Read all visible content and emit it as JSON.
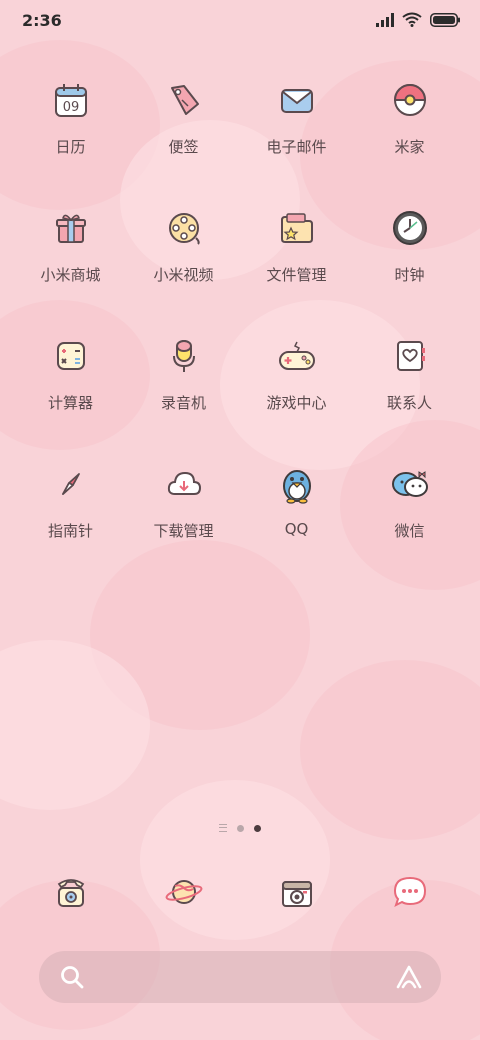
{
  "status_bar": {
    "time": "2:36"
  },
  "apps": [
    {
      "label": "日历",
      "icon": "calendar-icon",
      "day": "09"
    },
    {
      "label": "便签",
      "icon": "notes-icon"
    },
    {
      "label": "电子邮件",
      "icon": "email-icon"
    },
    {
      "label": "米家",
      "icon": "mijia-icon"
    },
    {
      "label": "小米商城",
      "icon": "gift-icon"
    },
    {
      "label": "小米视频",
      "icon": "film-reel-icon"
    },
    {
      "label": "文件管理",
      "icon": "folder-icon"
    },
    {
      "label": "时钟",
      "icon": "clock-icon"
    },
    {
      "label": "计算器",
      "icon": "calculator-icon"
    },
    {
      "label": "录音机",
      "icon": "microphone-icon"
    },
    {
      "label": "游戏中心",
      "icon": "gamepad-icon"
    },
    {
      "label": "联系人",
      "icon": "contacts-icon"
    },
    {
      "label": "指南针",
      "icon": "compass-icon"
    },
    {
      "label": "下载管理",
      "icon": "cloud-download-icon"
    },
    {
      "label": "QQ",
      "icon": "penguin-icon"
    },
    {
      "label": "微信",
      "icon": "wechat-icon"
    }
  ],
  "pager": {
    "pages": 2,
    "active_page": 2
  },
  "dock": [
    {
      "icon": "phone-icon"
    },
    {
      "icon": "planet-icon"
    },
    {
      "icon": "camera-icon"
    },
    {
      "icon": "messages-icon"
    }
  ],
  "search_bar": {
    "search_icon": "search-icon",
    "assistant_icon": "assistant-icon"
  },
  "colors": {
    "background": "#f9d3d8",
    "label": "#5a4a4d",
    "outline": "#5b4a4e"
  }
}
